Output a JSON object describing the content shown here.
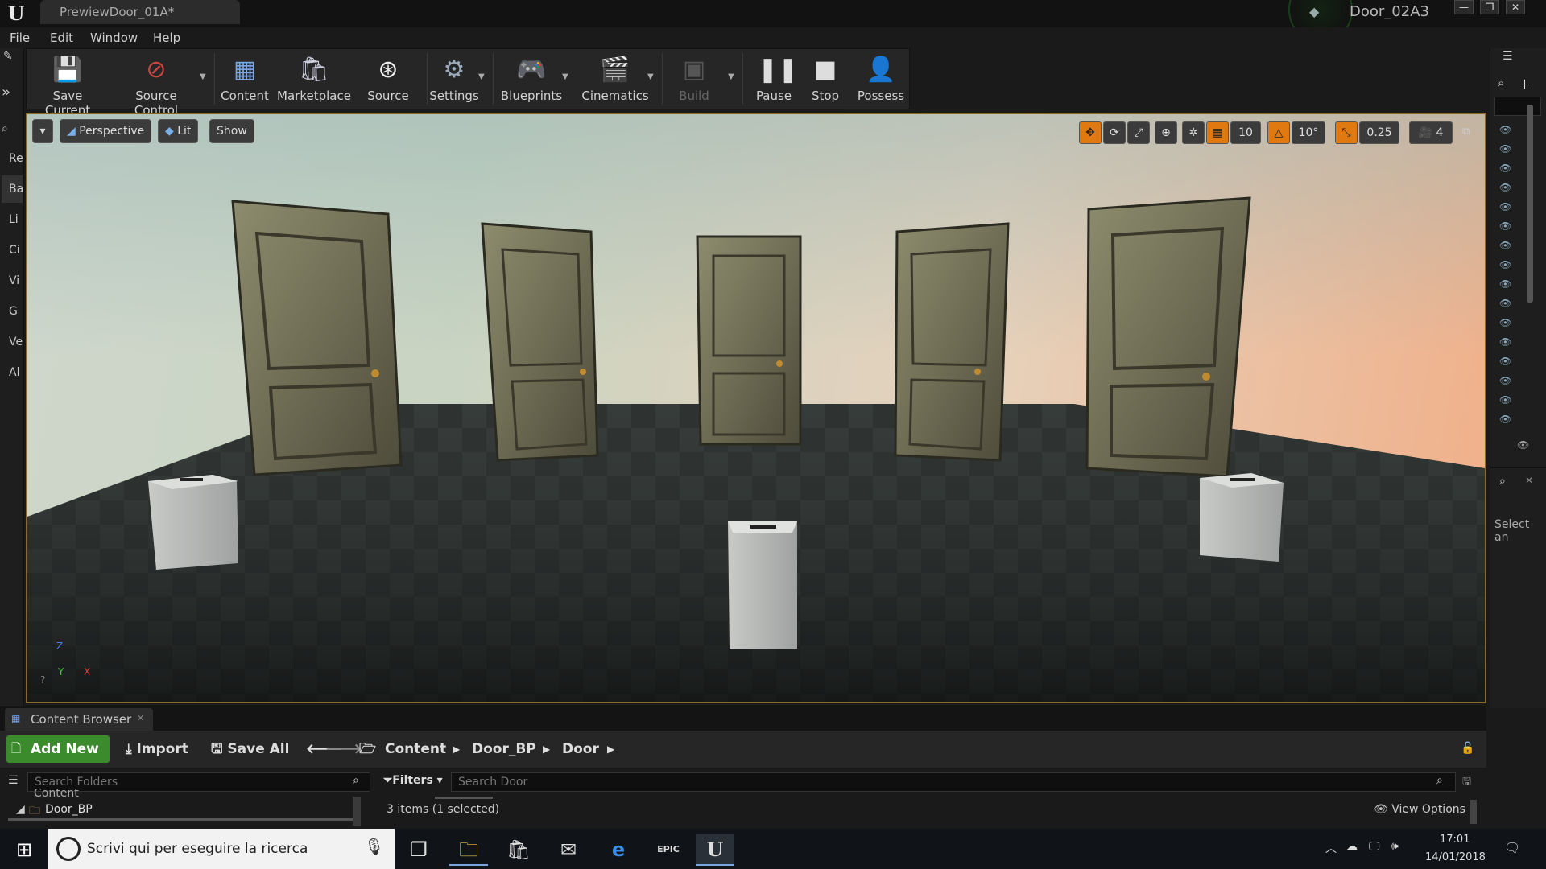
{
  "window": {
    "doc_tab": "PrewiewDoor_01A*",
    "project_name": "Door_02A3",
    "controls": [
      "—",
      "❐",
      "✕"
    ]
  },
  "menu": [
    "File",
    "Edit",
    "Window",
    "Help"
  ],
  "modes_tabs": [
    "Re",
    "Ba",
    "Li",
    "Ci",
    "Vi",
    "G",
    "Ve",
    "Al"
  ],
  "toolbar": {
    "save_current": "Save Current",
    "source_control": "Source Control",
    "content": "Content",
    "marketplace": "Marketplace",
    "source": "Source",
    "settings": "Settings",
    "blueprints": "Blueprints",
    "cinematics": "Cinematics",
    "build": "Build",
    "pause": "Pause",
    "stop": "Stop",
    "possess": "Possess"
  },
  "viewport": {
    "perspective": "Perspective",
    "lit": "Lit",
    "show": "Show",
    "grid_snap": "10",
    "rotation_snap": "10°",
    "scale_snap": "0.25",
    "camera_speed": "4",
    "axis_labels": [
      "Z",
      "Y",
      "X"
    ]
  },
  "right_panel": {
    "select_hint": "Select an"
  },
  "content_browser": {
    "tab_title": "Content Browser",
    "add_new": "Add New",
    "import": "Import",
    "save_all": "Save All",
    "breadcrumbs": [
      "Content",
      "Door_BP",
      "Door"
    ],
    "search_folders_placeholder": "Search Folders",
    "filters": "Filters",
    "search_assets_placeholder": "Search Door",
    "folder_root": "Content",
    "folder_child": "Door_BP",
    "items_status": "3 items (1 selected)",
    "view_options": "View Options"
  },
  "taskbar": {
    "search_text": "Scrivi qui per eseguire la ricerca",
    "time": "17:01",
    "date": "14/01/2018"
  },
  "colors": {
    "accent_green": "#3b8a2c",
    "viewport_border": "#8a6a2a",
    "snap_orange": "#e07a10"
  }
}
